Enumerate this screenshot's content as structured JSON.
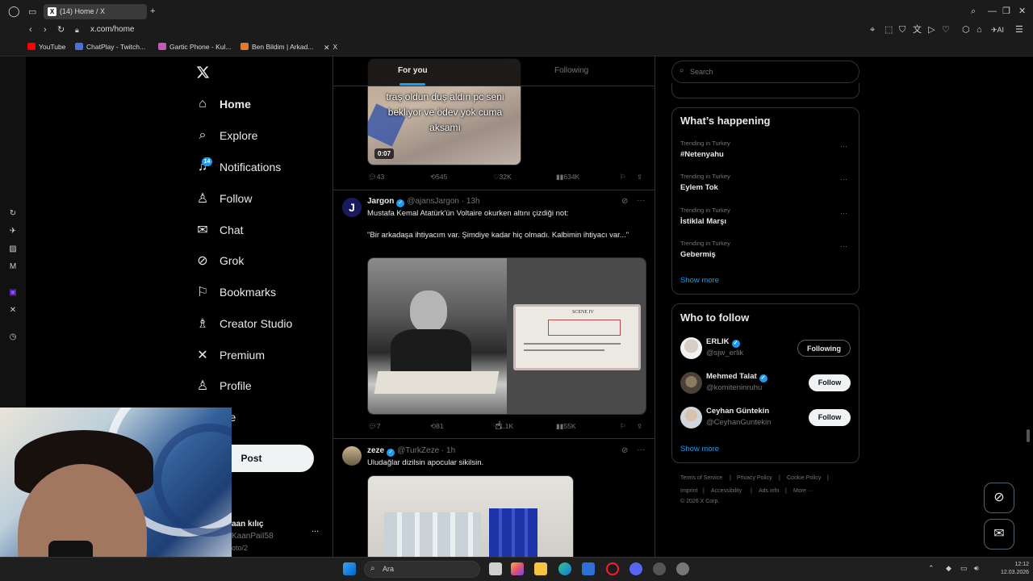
{
  "browser": {
    "tab_title": "(14) Home / X",
    "url": "x.com/home",
    "bookmarks": [
      "YouTube",
      "ChatPlay - Twitch...",
      "Gartic Phone - Kul...",
      "Ben Bildim | Arkad...",
      "X"
    ]
  },
  "nav": {
    "items": [
      {
        "label": "Home",
        "icon": "home-icon"
      },
      {
        "label": "Explore",
        "icon": "search-icon"
      },
      {
        "label": "Notifications",
        "icon": "bell-icon"
      },
      {
        "label": "Follow",
        "icon": "follow-icon"
      },
      {
        "label": "Chat",
        "icon": "mail-icon"
      },
      {
        "label": "Grok",
        "icon": "grok-icon"
      },
      {
        "label": "Bookmarks",
        "icon": "bookmark-icon"
      },
      {
        "label": "Creator Studio",
        "icon": "creator-icon"
      },
      {
        "label": "Premium",
        "icon": "x-icon"
      },
      {
        "label": "Profile",
        "icon": "user-icon"
      },
      {
        "label": "ore",
        "icon": "more-icon"
      }
    ],
    "notifications_badge": "14",
    "post_label": "Post",
    "account_name": "aan kılıç",
    "account_handle": "KaanPaiI58",
    "account_extra": "oto/2",
    "account_more": "..."
  },
  "feed": {
    "tabs": [
      "For you",
      "Following"
    ],
    "tweet1": {
      "video_caption": "traş oldun duş aldın pc seni bekliyor ve ödev yok cuma aksamı",
      "duration": "0:07",
      "replies": "43",
      "reposts": "545",
      "likes": "32K",
      "views": "634K"
    },
    "tweet2": {
      "name": "Jargon",
      "handle": "@ajansJargon",
      "time": "· 13h",
      "avatar_letter": "J",
      "text_line1": "Mustafa Kemal Atatürk'ün Voltaire okurken altını çizdiği not:",
      "text_line2": "\"Bir arkadaşa ihtiyacım var. Şimdiye kadar hiç olmadı. Kalbimin ihtiyacı var...\"",
      "replies": "7",
      "reposts": "81",
      "likes": "1.1K",
      "views": "55K"
    },
    "tweet3": {
      "name": "zeze",
      "handle": "@TurkZeze",
      "time": "· 1h",
      "text": "Uludağlar dizilsin apocular sikilsin."
    }
  },
  "sidebar": {
    "search_placeholder": "Search",
    "happening_title": "What’s happening",
    "trends": [
      {
        "meta": "Trending in Turkey",
        "name": "#Netenyahu"
      },
      {
        "meta": "Trending in Turkey",
        "name": "Eylem Tok"
      },
      {
        "meta": "Trending in Turkey",
        "name": "İstiklal Marşı"
      },
      {
        "meta": "Trending in Turkey",
        "name": "Gebermiş"
      }
    ],
    "show_more": "Show more",
    "wtf_title": "Who to follow",
    "wtf": [
      {
        "name": "ERLIK",
        "handle": "@sjw_erlik",
        "button": "Following"
      },
      {
        "name": "Mehmed Talat",
        "handle": "@komiteninruhu",
        "button": "Follow"
      },
      {
        "name": "Ceyhan Güntekin",
        "handle": "@CeyhanGuntekin",
        "button": "Follow"
      }
    ],
    "footer": [
      "Terms of Service",
      "|",
      "Privacy Policy",
      "|",
      "Cookie Policy",
      "|",
      "Imprint",
      "|",
      "Accessibility",
      "|",
      "Ads info",
      "|",
      "More ···"
    ],
    "copyright": "© 2026 X Corp."
  },
  "taskbar": {
    "search_placeholder": "Ara",
    "time": "12:12",
    "date": "12.03.2026"
  },
  "colors": {
    "accent": "#1d9bf0",
    "background": "#000000",
    "muted": "#71767b"
  }
}
